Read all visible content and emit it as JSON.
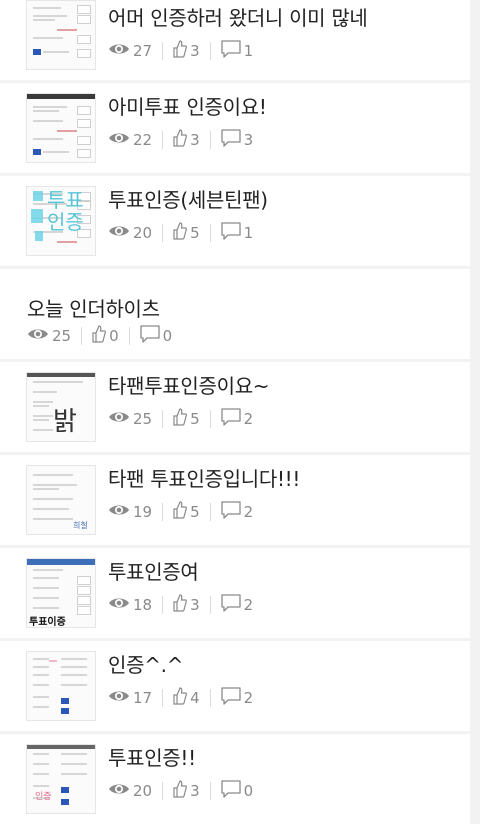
{
  "posts": [
    {
      "title": "어머 인증하러 왔더니 이미 많네",
      "views": "27",
      "likes": "3",
      "comments": "1",
      "has_thumb": true
    },
    {
      "title": "아미투표 인증이요!",
      "views": "22",
      "likes": "3",
      "comments": "3",
      "has_thumb": true
    },
    {
      "title": "투표인증(세븐틴팬)",
      "views": "20",
      "likes": "5",
      "comments": "1",
      "has_thumb": true
    },
    {
      "title": "오늘 인더하이츠",
      "views": "25",
      "likes": "0",
      "comments": "0",
      "has_thumb": false
    },
    {
      "title": "타팬투표인증이요~",
      "views": "25",
      "likes": "5",
      "comments": "2",
      "has_thumb": true
    },
    {
      "title": "타팬 투표인증입니다!!!",
      "views": "19",
      "likes": "5",
      "comments": "2",
      "has_thumb": true
    },
    {
      "title": "투표인증여",
      "views": "18",
      "likes": "3",
      "comments": "2",
      "has_thumb": true
    },
    {
      "title": "인증^.^",
      "views": "17",
      "likes": "4",
      "comments": "2",
      "has_thumb": true
    },
    {
      "title": "투표인증!!",
      "views": "20",
      "likes": "3",
      "comments": "0",
      "has_thumb": true
    }
  ],
  "icons": {
    "views": "eye-icon",
    "likes": "thumbs-up-icon",
    "comments": "comment-icon"
  },
  "colors": {
    "background": "#f2f2f2",
    "card": "#ffffff",
    "text": "#222222",
    "meta": "#8a8a8a"
  }
}
